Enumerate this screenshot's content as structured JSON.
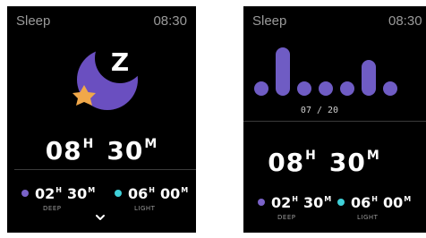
{
  "colors": {
    "deep": "#7a62c8",
    "light": "#3fd0d8",
    "moon": "#6a4fc0",
    "star": "#f0a84a",
    "bar": "#6f5cc4"
  },
  "screen_a": {
    "title": "Sleep",
    "time": "08:30",
    "icon": "moon-star-zzz-icon",
    "z_letter": "Z",
    "total": {
      "hours": "08",
      "h_unit": "H",
      "minutes": "30",
      "m_unit": "M"
    },
    "deep": {
      "hours": "02",
      "h_unit": "H",
      "minutes": "30",
      "m_unit": "M",
      "label": "DEEP"
    },
    "light": {
      "hours": "06",
      "h_unit": "H",
      "minutes": "00",
      "m_unit": "M",
      "label": "LIGHT"
    },
    "chevron": "chevron-down-icon"
  },
  "screen_b": {
    "title": "Sleep",
    "time": "08:30",
    "date": "07 / 20",
    "total": {
      "hours": "08",
      "h_unit": "H",
      "minutes": "30",
      "m_unit": "M"
    },
    "deep": {
      "hours": "02",
      "h_unit": "H",
      "minutes": "30",
      "m_unit": "M",
      "label": "DEEP"
    },
    "light": {
      "hours": "06",
      "h_unit": "H",
      "minutes": "00",
      "m_unit": "M",
      "label": "LIGHT"
    }
  },
  "chart_data": {
    "type": "bar",
    "values": [
      1,
      4,
      1,
      1,
      1,
      3,
      1
    ],
    "note_levels": "relative bar heights in arbitrary units"
  }
}
